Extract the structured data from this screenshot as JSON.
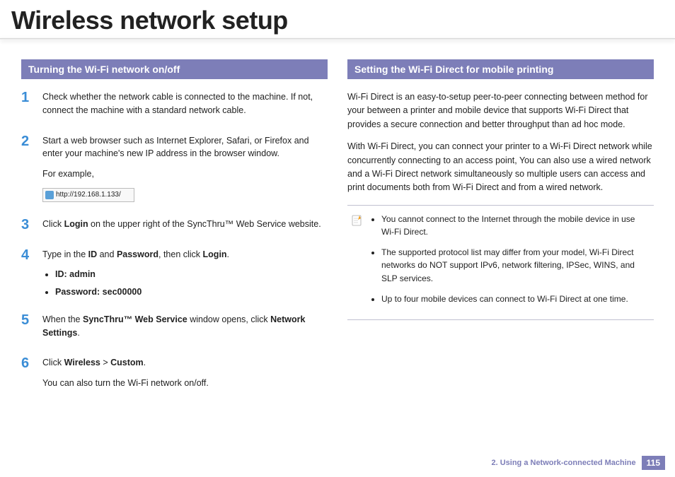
{
  "title": "Wireless network setup",
  "section_left_header": "Turning the Wi-Fi network on/off",
  "section_right_header": "Setting the Wi-Fi Direct for mobile printing",
  "steps": {
    "s1": {
      "num": "1",
      "text": "Check whether the network cable is connected to the machine. If not, connect the machine with a standard network cable."
    },
    "s2": {
      "num": "2",
      "text": "Start a web browser such as Internet Explorer, Safari, or Firefox and enter your machine's new IP address in the browser window.",
      "extra": "For example,",
      "url": "http://192.168.1.133/"
    },
    "s3": {
      "num": "3",
      "pre": "Click ",
      "b1": "Login",
      "post": " on the upper right of the SyncThru™ Web Service website."
    },
    "s4": {
      "num": "4",
      "pre": "Type in the ",
      "b1": "ID",
      "mid1": " and ",
      "b2": "Password",
      "mid2": ", then click ",
      "b3": "Login",
      "post": ".",
      "id_label": "ID: admin",
      "pw_label": "Password: sec00000"
    },
    "s5": {
      "num": "5",
      "pre": "When the ",
      "b1": "SyncThru™ Web Service",
      "mid": " window opens, click ",
      "b2": "Network Settings",
      "post": "."
    },
    "s6": {
      "num": "6",
      "pre": "Click ",
      "b1": "Wireless",
      "mid": " > ",
      "b2": "Custom",
      "post": ".",
      "extra": "You can also turn the Wi-Fi network on/off."
    }
  },
  "right_p1": "Wi-Fi Direct is an easy-to-setup peer-to-peer connecting between method for your between a printer and mobile device that supports Wi-Fi Direct that provides a secure connection and better throughput than ad hoc mode.",
  "right_p2": "With Wi-Fi Direct, you can connect your printer to a Wi-Fi Direct network while concurrently connecting to an access point, You can also use a wired network and a Wi-Fi Direct network simultaneously so multiple users can access and print documents both from Wi-Fi Direct and from a wired network.",
  "notes": {
    "n1": "You cannot connect to the Internet through the mobile device in use Wi-Fi Direct.",
    "n2": "The supported protocol list may differ from your model, Wi-Fi Direct networks do NOT support IPv6, network filtering, IPSec, WINS, and SLP services.",
    "n3": "Up to four mobile devices can connect to Wi-Fi Direct at one time."
  },
  "footer_chapter": "2.  Using a Network-connected Machine",
  "footer_page": "115"
}
